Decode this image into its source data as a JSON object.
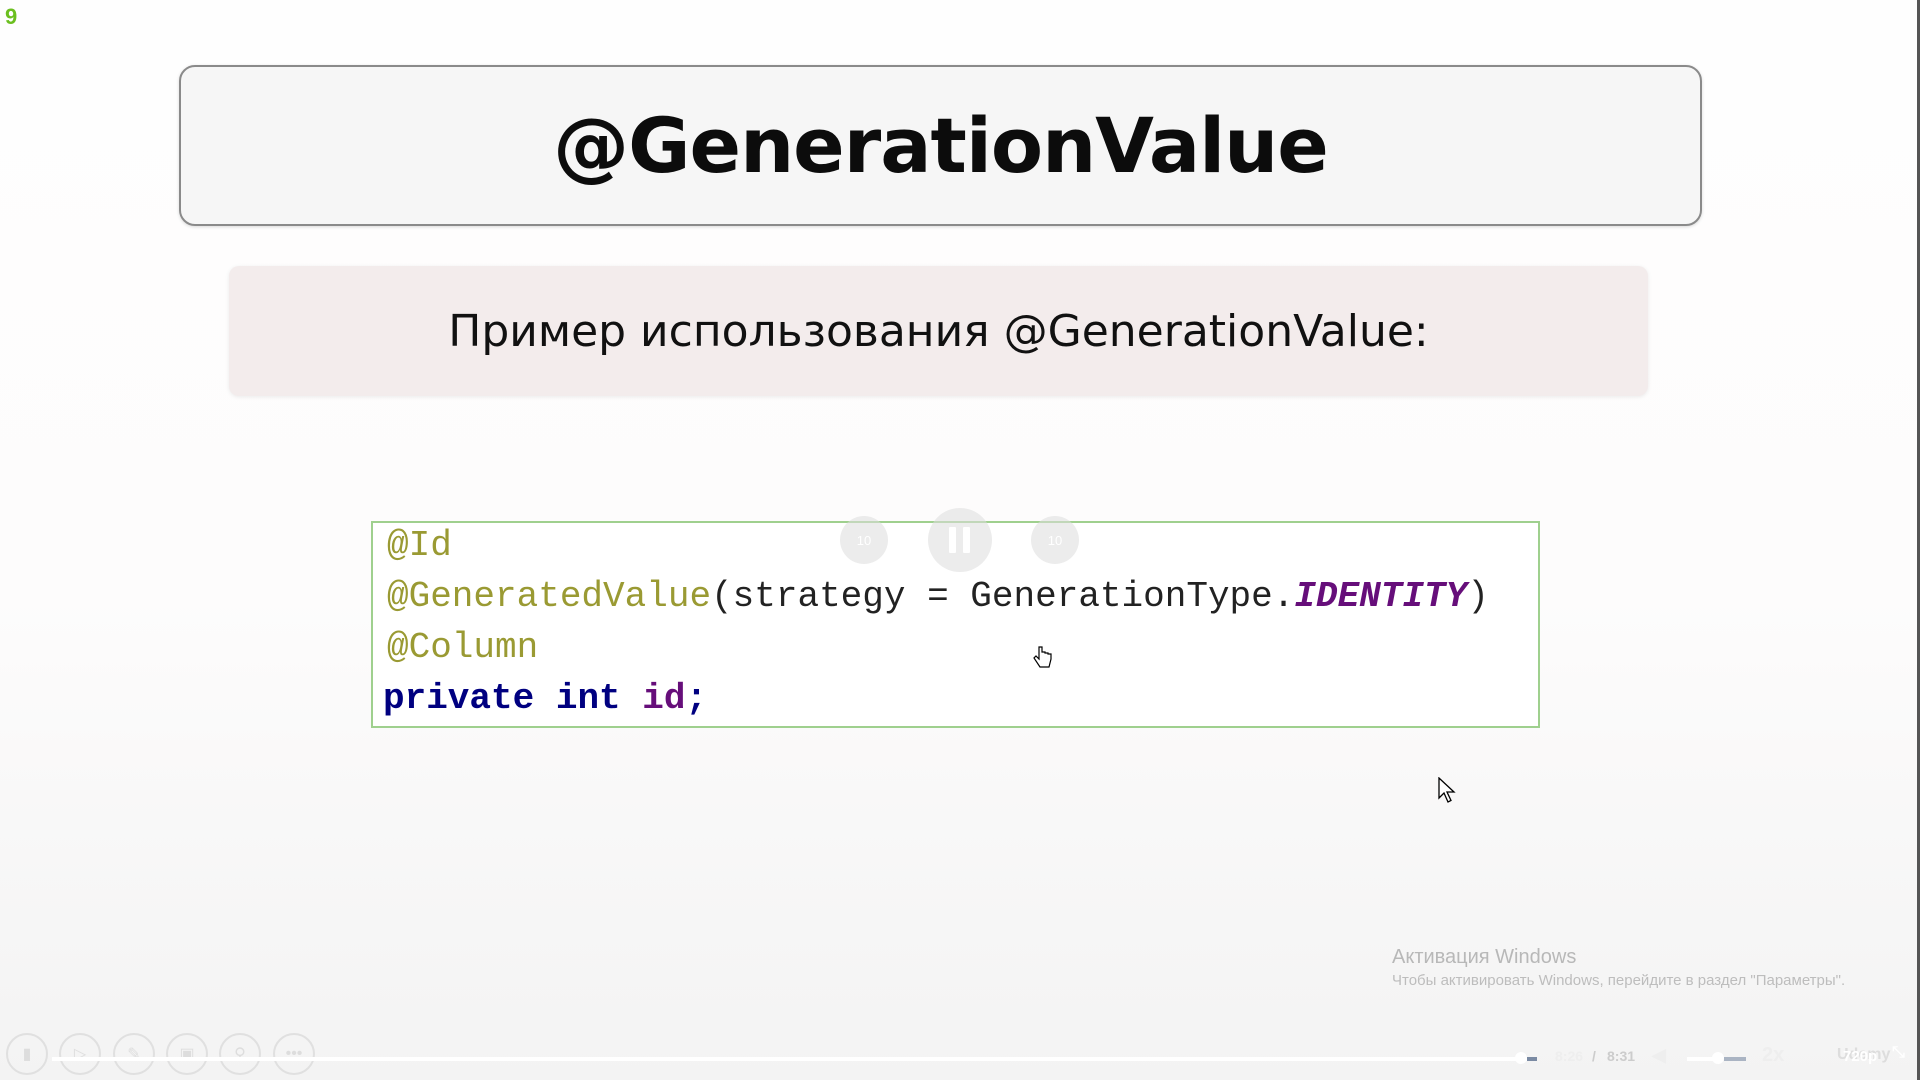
{
  "slide_number": "9",
  "title": "@GenerationValue",
  "subtitle": "Пример использования @GenerationValue:",
  "code": {
    "line1": "@Id",
    "line2_annotation": "@GeneratedValue",
    "line2_args": "(strategy = GenerationType.",
    "line2_const": "IDENTITY",
    "line2_close": ")",
    "line3": "@Column",
    "line4_kw1": "private",
    "line4_kw2": "int",
    "line4_var": "id",
    "line4_end": ";"
  },
  "overlay": {
    "rewind_label": "10",
    "forward_label": "10",
    "pause_icon": "pause-icon"
  },
  "player": {
    "current_time": "8:26",
    "separator": "/",
    "duration": "8:31",
    "progress_fraction": 0.984,
    "volume_fraction": 0.5,
    "speed": "2x",
    "quality": "720p",
    "logo": "Udemy"
  },
  "toolbar_icons": [
    "slide-sorter-icon",
    "play-icon",
    "pen-icon",
    "slides-icon",
    "zoom-icon",
    "more-icon"
  ],
  "watermark": {
    "title": "Активация Windows",
    "text": "Чтобы активировать Windows, перейдите в раздел \"Параметры\"."
  },
  "colors": {
    "slide_number": "#6bbf1f",
    "code_border": "#9fd08e",
    "annotation": "#9a9a33",
    "keyword": "#000080",
    "constant": "#660e7a"
  }
}
